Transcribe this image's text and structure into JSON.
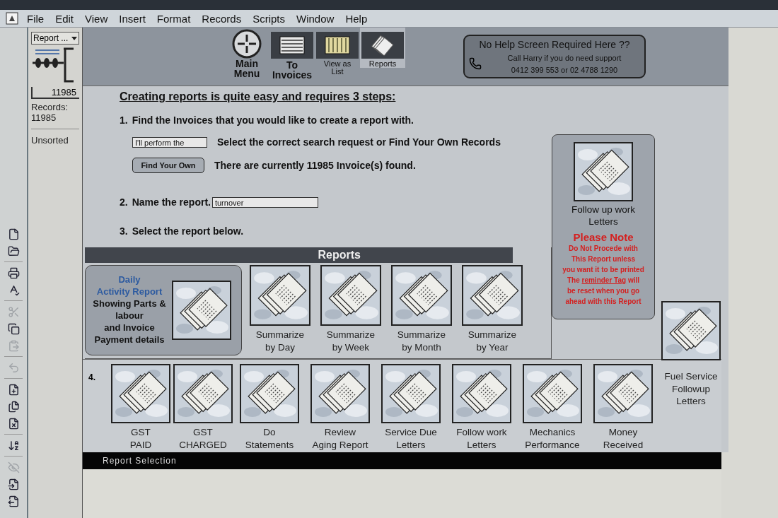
{
  "menu": [
    "File",
    "Edit",
    "View",
    "Insert",
    "Format",
    "Records",
    "Scripts",
    "Window",
    "Help"
  ],
  "status_panel": {
    "layout_menu": "Report ...",
    "record_number": "11985",
    "records_label": "Records:",
    "records_count": "11985",
    "sort_status": "Unsorted"
  },
  "toolbar_groups": [
    [
      {
        "kind": "new",
        "disabled": false
      },
      {
        "kind": "open",
        "disabled": false
      }
    ],
    [
      {
        "kind": "print",
        "disabled": false
      },
      {
        "kind": "spelling",
        "disabled": false
      }
    ],
    [
      {
        "kind": "cut",
        "disabled": true
      },
      {
        "kind": "copy",
        "disabled": false
      },
      {
        "kind": "paste",
        "disabled": true
      }
    ],
    [
      {
        "kind": "undo",
        "disabled": true
      }
    ],
    [
      {
        "kind": "new-record",
        "disabled": false
      },
      {
        "kind": "duplicate-record",
        "disabled": false
      },
      {
        "kind": "delete-record",
        "disabled": false
      }
    ],
    [
      {
        "kind": "sort",
        "disabled": false
      }
    ],
    [
      {
        "kind": "omit",
        "disabled": true
      },
      {
        "kind": "import",
        "disabled": false
      },
      {
        "kind": "export",
        "disabled": false
      }
    ]
  ],
  "nav": [
    {
      "kind": "round",
      "label": "Main\nMenu",
      "large": true,
      "selected": false
    },
    {
      "kind": "lines",
      "label": "To\nInvoices",
      "large": true,
      "selected": false
    },
    {
      "kind": "grid",
      "label": "View as\nList",
      "large": false,
      "selected": false
    },
    {
      "kind": "pages",
      "label": "Reports",
      "large": false,
      "selected": true
    }
  ],
  "help": {
    "title": "No Help Screen Required Here  ??",
    "line": "Call Harry if you do need support",
    "phone": "0412 399 553 or 02 4788 1290"
  },
  "steps": {
    "heading": "Creating reports is quite easy and requires 3 steps:",
    "step1": {
      "number": "1.",
      "text": "Find the Invoices that you would like to create a report with."
    },
    "search": {
      "value": "I'll perform the",
      "text": "Select the correct search request or Find Your Own Records"
    },
    "find": {
      "button": "Find Your Own",
      "text": "There are currently 11985 Invoice(s) found."
    },
    "step2": {
      "number": "2.",
      "text": "Name the report.",
      "value": "turnover"
    },
    "step3": {
      "number": "3.",
      "text": "Select the report below."
    }
  },
  "reports": {
    "title": "Reports",
    "featured": {
      "title": "Daily\nActivity Report",
      "description": "Showing Parts &\nlabour\nand Invoice\nPayment details"
    },
    "items": [
      {
        "label": "Summarize\nby Day"
      },
      {
        "label": "Summarize\nby Week"
      },
      {
        "label": "Summarize\nby Month"
      },
      {
        "label": "Summarize\nby Year"
      }
    ]
  },
  "follow_card": {
    "label": "Follow up work\nLetters",
    "note_title": "Please Note",
    "notice": {
      "before": "Do Not Procede with\nThis Report unless\nyou want it to be printed\nThe ",
      "link": "reminder Tag",
      "after": " will\nbe reset when you go\nahead with this Report"
    }
  },
  "fuel": {
    "label": "Fuel Service\nFollowup\nLetters"
  },
  "step4": {
    "number": "4.",
    "items": [
      {
        "label": "GST\nPAID"
      },
      {
        "label": "GST\nCHARGED"
      },
      {
        "label": "Do\nStatements"
      },
      {
        "label": "Review\nAging Report"
      },
      {
        "label": "Service Due\nLetters"
      },
      {
        "label": "Follow work\nLetters"
      },
      {
        "label": "Mechanics\nPerformance"
      },
      {
        "label": "Money\nReceived"
      }
    ]
  },
  "status_bar": "Report Selection"
}
